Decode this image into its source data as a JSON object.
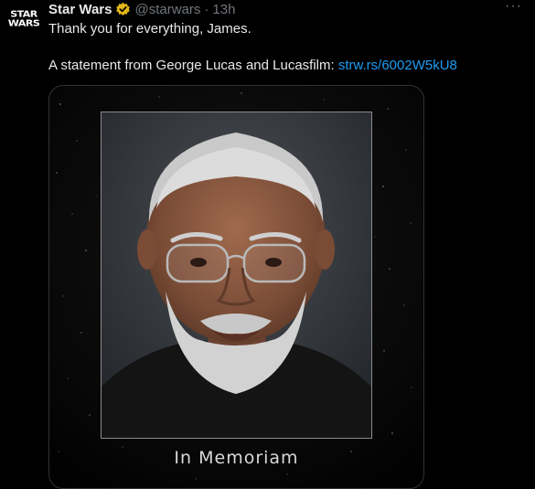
{
  "account": {
    "avatar_line1": "STAR",
    "avatar_line2": "WARS",
    "name": "Star Wars",
    "handle": "@starwars",
    "separator": "·",
    "time": "13h",
    "verified_color": "#e2b719"
  },
  "menu": {
    "more_label": "···"
  },
  "tweet": {
    "line1": "Thank you for everything, James.",
    "line2_prefix": "A statement from George Lucas and Lucasfilm: ",
    "link": "strw.rs/6002W5kU8",
    "link_color": "#1d9bf0"
  },
  "media": {
    "caption": "In Memoriam",
    "photo_icon": "portrait-photo"
  }
}
